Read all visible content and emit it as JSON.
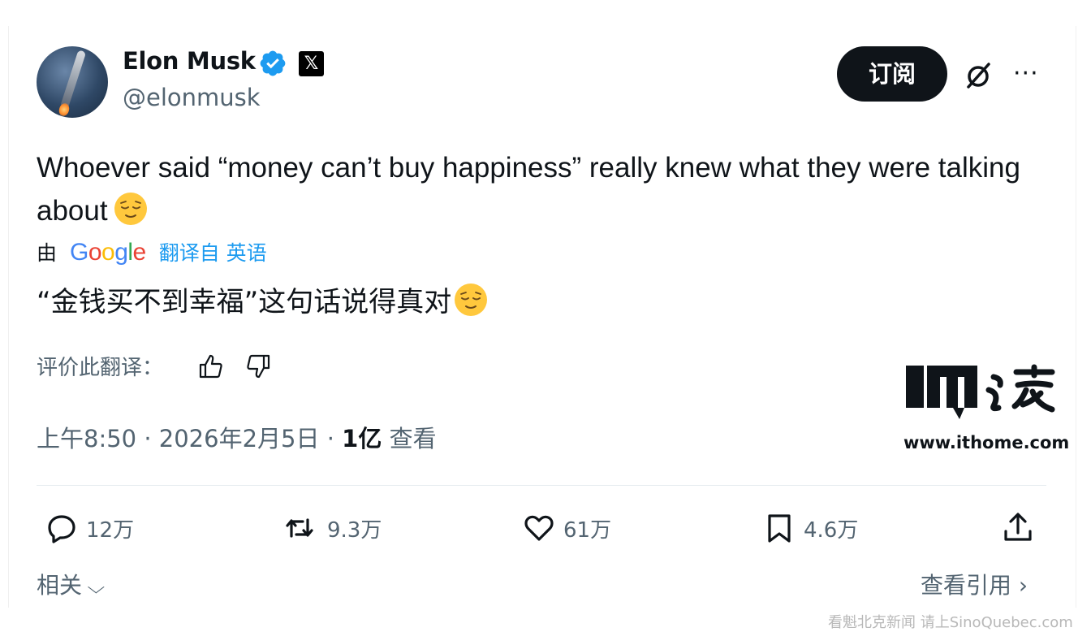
{
  "author": {
    "name": "Elon Musk",
    "handle": "@elonmusk",
    "x_badge": "𝕏"
  },
  "header": {
    "subscribe_label": "订阅",
    "more_label": "···"
  },
  "tweet": {
    "text": "Whoever said “money can’t buy happiness” really knew what they were talking about",
    "translation_prefix": "由",
    "translation_provider": "Google",
    "translation_suffix": "翻译自 英语",
    "translation": "“金钱买不到幸福”这句话说得真对",
    "rate_translation_label": "评价此翻译："
  },
  "meta": {
    "time": "上午8:50",
    "date": "2026年2月5日",
    "separator": "·",
    "views_count": "1亿",
    "views_label": "查看"
  },
  "watermark_logo": {
    "url": "www.ithome.com"
  },
  "actions": {
    "replies": "12万",
    "reposts": "9.3万",
    "likes": "61万",
    "bookmarks": "4.6万"
  },
  "footer": {
    "related_label": "相关",
    "quotes_label": "查看引用"
  },
  "page_watermark": "看魁北克新闻 请上SinoQuebec.com",
  "icons": {
    "verified": "verified-badge-icon",
    "grok": "grok-icon",
    "reply": "reply-icon",
    "repost": "repost-icon",
    "like": "heart-icon",
    "bookmark": "bookmark-icon",
    "share": "share-icon",
    "thumbs_up": "thumbs-up-icon",
    "thumbs_down": "thumbs-down-icon",
    "emoji": "relieved-face-emoji"
  },
  "colors": {
    "verified_blue": "#1d9bf0",
    "text_primary": "#0f1419",
    "text_secondary": "#536471",
    "subscribe_bg": "#0f1419"
  }
}
